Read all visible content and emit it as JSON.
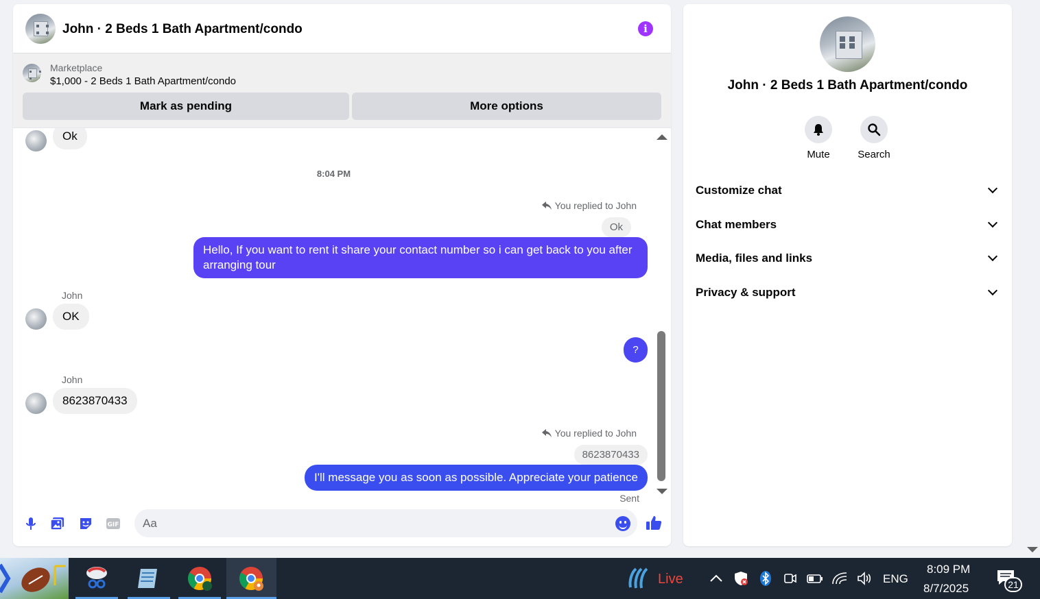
{
  "chat": {
    "title": "John · 2 Beds 1 Bath Apartment/condo",
    "marketplace_label": "Marketplace",
    "listing": "$1,000 - 2 Beds 1 Bath Apartment/condo",
    "mark_pending_label": "Mark as pending",
    "more_options_label": "More options"
  },
  "messages": {
    "first_incoming": "Ok",
    "timestamp": "8:04 PM",
    "reply_label_1": "You replied to John",
    "quote_1": "Ok",
    "outgoing_1_line1": "Hello, If you want to rent it share your contact number so i can get back to you after",
    "outgoing_1_line2": "arranging tour",
    "sender_1": "John",
    "incoming_2": "OK",
    "outgoing_2": "?",
    "sender_2": "John",
    "incoming_3": "8623870433",
    "reply_label_2": "You replied to John",
    "quote_2": "8623870433",
    "outgoing_3": "I'll message you as soon as possible. Appreciate your patience",
    "status": "Sent"
  },
  "composer": {
    "placeholder": "Aa"
  },
  "details": {
    "title": "John · 2 Beds 1 Bath Apartment/condo",
    "mute_label": "Mute",
    "search_label": "Search",
    "sections": [
      "Customize chat",
      "Chat members",
      "Media, files and links",
      "Privacy & support"
    ]
  },
  "taskbar": {
    "live_label": "Live",
    "language": "ENG",
    "time": "8:09 PM",
    "date": "8/7/2025",
    "notification_count": "21"
  },
  "colors": {
    "accent": "#3a4ef0",
    "purple_bubble": "#5842f4",
    "info": "#a033ff",
    "taskbar": "#1c2532",
    "live_red": "#e8483d"
  }
}
